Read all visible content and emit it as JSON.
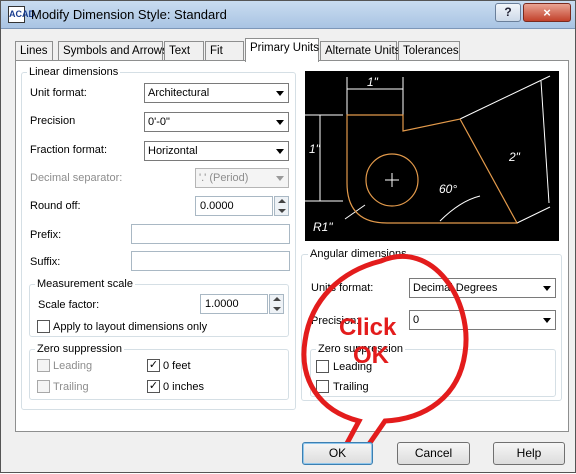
{
  "window": {
    "title": "Modify Dimension Style: Standard",
    "app_icon": "ACAD",
    "help_label": "?",
    "close_label": "×"
  },
  "tabs": [
    "Lines",
    "Symbols and Arrows",
    "Text",
    "Fit",
    "Primary Units",
    "Alternate Units",
    "Tolerances"
  ],
  "active_tab": "Primary Units",
  "linear": {
    "title": "Linear dimensions",
    "unit_format": {
      "label": "Unit format:",
      "value": "Architectural"
    },
    "precision": {
      "label": "Precision",
      "value": "0'-0\""
    },
    "fraction_format": {
      "label": "Fraction format:",
      "value": "Horizontal"
    },
    "decimal_separator": {
      "label": "Decimal separator:",
      "value": "'.' (Period)"
    },
    "round_off": {
      "label": "Round off:",
      "value": "0.0000"
    },
    "prefix": {
      "label": "Prefix:",
      "value": ""
    },
    "suffix": {
      "label": "Suffix:",
      "value": ""
    }
  },
  "measurement": {
    "title": "Measurement scale",
    "scale_label": "Scale factor:",
    "scale_value": "1.0000",
    "apply_layout_label": "Apply to layout dimensions only",
    "apply_layout_checked": false
  },
  "zero_linear": {
    "title": "Zero suppression",
    "leading": "Leading",
    "trailing": "Trailing",
    "feet": "0 feet",
    "inches": "0 inches",
    "feet_checked": true,
    "inches_checked": true
  },
  "preview": {
    "dim_top": "1\"",
    "dim_left": "1\"",
    "dim_right": "2\"",
    "angle": "60°",
    "radius": "R1\""
  },
  "angular": {
    "title": "Angular dimensions",
    "units_format": {
      "label": "Units format:",
      "value": "Decimal Degrees"
    },
    "precision": {
      "label": "Precision:",
      "value": "0"
    }
  },
  "zero_angular": {
    "title": "Zero suppression",
    "leading": "Leading",
    "trailing": "Trailing"
  },
  "buttons": {
    "ok": "OK",
    "cancel": "Cancel",
    "help": "Help"
  },
  "annotation": {
    "line1": "Click",
    "line2": "OK",
    "color": "#e31c1c"
  },
  "check_mark": "✓"
}
